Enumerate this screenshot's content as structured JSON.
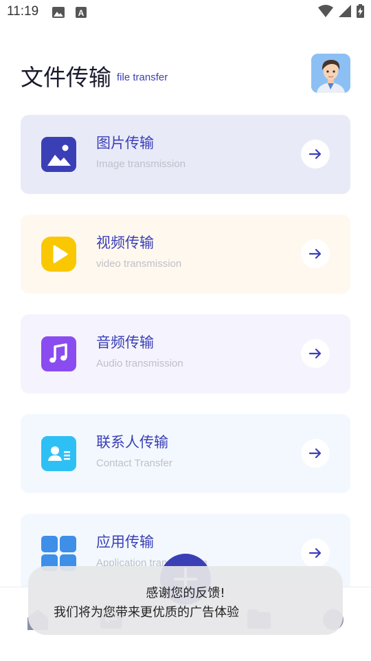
{
  "status_bar": {
    "time": "11:19"
  },
  "header": {
    "title": "文件传输",
    "subtitle": "file transfer"
  },
  "cards": [
    {
      "title": "图片传输",
      "subtitle": "Image transmission",
      "icon": "image-icon",
      "bg": "#e8eaf8",
      "icon_color": "#3b3fb6"
    },
    {
      "title": "视频传输",
      "subtitle": "video transmission",
      "icon": "play-icon",
      "bg": "#fff8ef",
      "icon_color": "#f9c802"
    },
    {
      "title": "音频传输",
      "subtitle": "Audio transmission",
      "icon": "music-icon",
      "bg": "#f5f3fd",
      "icon_color": "#8a4cf0"
    },
    {
      "title": "联系人传输",
      "subtitle": "Contact Transfer",
      "icon": "contact-card-icon",
      "bg": "#f2f8fe",
      "icon_color": "#2ec0f5"
    },
    {
      "title": "应用传输",
      "subtitle": "Application transmission",
      "icon": "apps-grid-icon",
      "bg": "#f2f8fe",
      "icon_color": "#3d8fe8"
    }
  ],
  "toast": {
    "line1": "感谢您的反馈!",
    "line2": "我们将为您带来更优质的广告体验"
  },
  "colors": {
    "accent": "#3b3fb6"
  }
}
